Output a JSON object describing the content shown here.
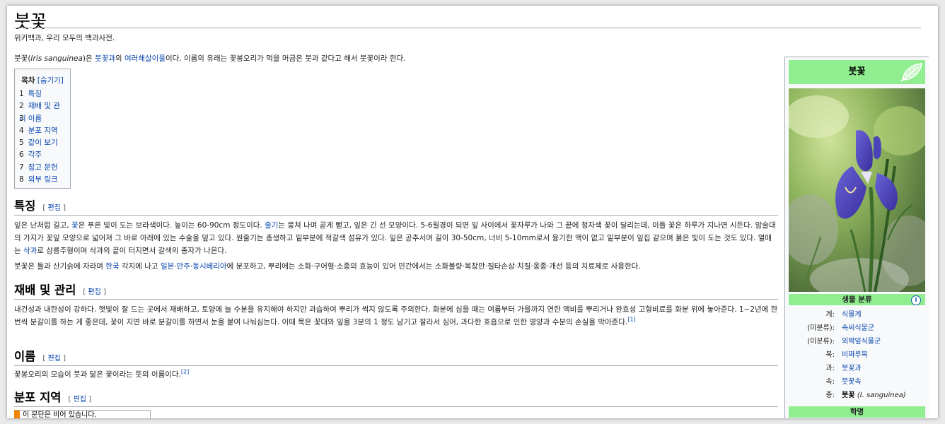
{
  "title": "붓꽃",
  "tagline": "위키백과, 우리 모두의 백과사전.",
  "intro": {
    "before": "붓꽃(",
    "sci_name": "Iris sanguinea",
    "mid1": ")은 ",
    "link1": "붓꽃과",
    "mid2": "의 ",
    "link2": "여러해살이풀",
    "after": "이다. 이름의 유래는 꽃봉오리가 먹을 머금은 붓과 같다고 해서 붓꽃이라 한다."
  },
  "toc": {
    "title": "목차",
    "toggle": "[숨기기]",
    "items": [
      {
        "num": "1",
        "label": "특징"
      },
      {
        "num": "2",
        "label": "재배 및 관리"
      },
      {
        "num": "3",
        "label": "이름"
      },
      {
        "num": "4",
        "label": "분포 지역"
      },
      {
        "num": "5",
        "label": "같이 보기"
      },
      {
        "num": "6",
        "label": "각주"
      },
      {
        "num": "7",
        "label": "참고 문헌"
      },
      {
        "num": "8",
        "label": "외부 링크"
      }
    ]
  },
  "edit_bracket_open": "[",
  "edit_label": "편집",
  "edit_bracket_close": "]",
  "sections": {
    "features": {
      "heading": "특징",
      "p1_a": "잎은 난처럼 길고, ",
      "p1_link1": "꽃",
      "p1_b": "은 푸른 빛이 도는 보라색이다. 높이는 60-90cm 정도이다. ",
      "p1_link2": "줄기",
      "p1_c": "는 뭉쳐 나며 곧게 뻗고, 잎은 긴 선 모양이다. 5-6월경이 되면 잎 사이에서 꽃자루가 나와 그 끝에 청자색 꽃이 달리는데, 이들 꽃은 하루가 지나면 시든다. 암술대의 가지가 꽃잎 모양으로 넓어져 그 바로 아래에 있는 수술을 덮고 있다. 원줄기는 총생하고 밑부분에 적갈색 섬유가 있다. 잎은 곧추서며 길이 30-50cm, 너비 5-10mm로서 융기한 맥이 없고 밑부분이 잎집 같으며 붉은 빛이 도는 것도 있다. 열매는 ",
      "p1_link3": "삭과",
      "p1_d": "로 삼릉주형이며 삭과의 끝이 터지면서 갈색의 종자가 나온다.",
      "p2_a": "붓꽃은 들과 산기슭에 자라며 ",
      "p2_link1": "한국",
      "p2_b": " 각지에 나고 ",
      "p2_link2": "일본",
      "p2_sep1": "·",
      "p2_link3": "만주",
      "p2_sep2": "·",
      "p2_link4": "동시베리아",
      "p2_c": "에 분포하고, 뿌리에는 소화·구어혈·소종의 효능이 있어 민간에서는 소화불량·복창만·질타손상·치질·옹종·개선 등의 치료제로 사용한다."
    },
    "cultivation": {
      "heading": "재배 및 관리",
      "text": "내건성과 내한성이 강하다. 햇빛이 잘 드는 곳에서 재배하고, 토양에 늘 수분을 유지해야 하지만 과습하여 뿌리가 썩지 않도록 주의한다. 화분에 심을 때는 여름부터 가을까지 연한 액비를 뿌리거나 완효성 고형비료를 화분 위에 놓아준다. 1~2년에 한번씩 분갈이를 하는 게 좋은데, 꽃이 지면 바로 분갈이를 하면서 눈을 붙여 나눠심는다. 이때 묵은 꽃대와 잎을 3분의 1 정도 남기고 잘라서 심어, 과다한 호흡으로 인한 영양과 수분의 손실을 막아준다.",
      "ref": "[1]"
    },
    "name": {
      "heading": "이름",
      "text": "꽃봉오리의 모습이 붓과 닮은 꽃이라는 뜻의 이름이다.",
      "ref": "[2]"
    },
    "distribution": {
      "heading": "분포 지역",
      "notice": "이 문단은 비어 있습니다."
    }
  },
  "infobox": {
    "title": "붓꽃",
    "classification_header": "생물 분류",
    "rows": [
      {
        "key": "계:",
        "value": "식물계"
      },
      {
        "key": "(미분류):",
        "value": "속씨식물군"
      },
      {
        "key": "(미분류):",
        "value": "외떡잎식물군"
      },
      {
        "key": "목:",
        "value": "비짜루목"
      },
      {
        "key": "과:",
        "value": "붓꽃과"
      },
      {
        "key": "속:",
        "value": "붓꽃속"
      }
    ],
    "species": {
      "key": "종:",
      "value": "붓꽃",
      "sci": "(I. sanguinea)"
    },
    "binomial_header": "학명"
  },
  "colors": {
    "infobox_header": "#90ee90",
    "link": "#0645ad",
    "notice_bar": "#f28500"
  }
}
